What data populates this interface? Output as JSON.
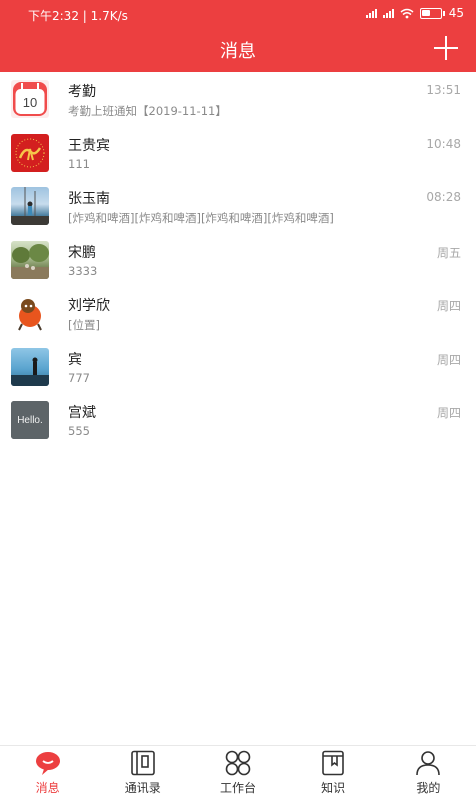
{
  "status_bar": {
    "left_text": "下午2:32 | 1.7K/s",
    "battery_text": "45",
    "battery_level": 0.45
  },
  "header": {
    "title": "消息",
    "add_icon": "plus-icon"
  },
  "messages": [
    {
      "name": "考勤",
      "preview": "考勤上班通知【2019-11-11】",
      "time": "13:51",
      "avatar": "calendar-avatar",
      "avatar_text": "10"
    },
    {
      "name": "王贵宾",
      "preview": "111",
      "time": "10:48",
      "avatar": "red-logo-avatar"
    },
    {
      "name": "张玉南",
      "preview": "[炸鸡和啤酒][炸鸡和啤酒][炸鸡和啤酒][炸鸡和啤酒]",
      "time": "08:28",
      "avatar": "photo-avatar"
    },
    {
      "name": "宋鹏",
      "preview": "3333",
      "time": "周五",
      "avatar": "photo-avatar"
    },
    {
      "name": "刘学欣",
      "preview": "[位置]",
      "time": "周四",
      "avatar": "cartoon-avatar"
    },
    {
      "name": "宾",
      "preview": "777",
      "time": "周四",
      "avatar": "photo-avatar"
    },
    {
      "name": "宫斌",
      "preview": "555",
      "time": "周四",
      "avatar": "hello-avatar",
      "avatar_text": "Hello."
    }
  ],
  "tabs": [
    {
      "label": "消息",
      "icon": "chat-bubble-icon",
      "active": true
    },
    {
      "label": "通讯录",
      "icon": "contacts-book-icon",
      "active": false
    },
    {
      "label": "工作台",
      "icon": "grid-clover-icon",
      "active": false
    },
    {
      "label": "知识",
      "icon": "bookmark-book-icon",
      "active": false
    },
    {
      "label": "我的",
      "icon": "person-icon",
      "active": false
    }
  ],
  "colors": {
    "brand_red": "#ec3f40",
    "time_gray": "#a8a8a8",
    "preview_gray": "#8a8a8a"
  }
}
